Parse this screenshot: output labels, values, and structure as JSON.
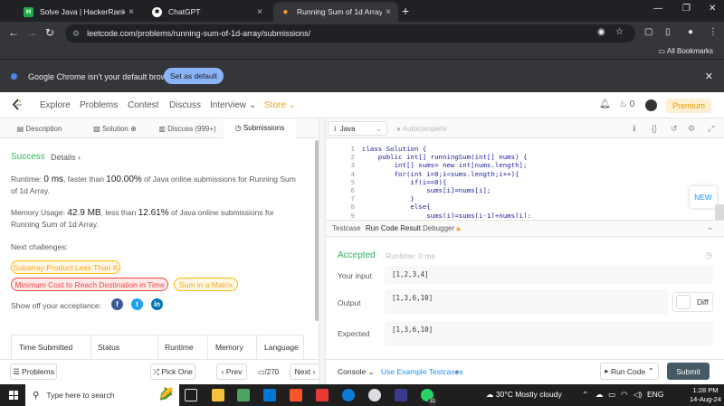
{
  "browser": {
    "tabs": [
      {
        "title": "Solve Java | HackerRank",
        "active": false
      },
      {
        "title": "ChatGPT",
        "active": false
      },
      {
        "title": "Running Sum of 1d Array - Lee",
        "active": true
      }
    ],
    "url": "leetcode.com/problems/running-sum-of-1d-array/submissions/",
    "all_bookmarks": "All Bookmarks",
    "infobar": {
      "message": "Google Chrome isn't your default browser",
      "button": "Set as default"
    }
  },
  "leetcode_nav": {
    "items": [
      "Explore",
      "Problems",
      "Contest",
      "Discuss",
      "Interview",
      "Store"
    ],
    "streak": "0",
    "premium": "Premium"
  },
  "left": {
    "tabs": [
      "Description",
      "Solution",
      "Discuss (999+)",
      "Submissions"
    ],
    "status": "Success",
    "details": "Details",
    "runtime_prefix": "Runtime: ",
    "runtime_value": "0 ms",
    "runtime_mid": ", faster than ",
    "runtime_pct": "100.00%",
    "runtime_suffix": " of Java online submissions for Running Sum of 1d Array.",
    "memory_prefix": "Memory Usage: ",
    "memory_value": "42.9 MB",
    "memory_mid": ", less than ",
    "memory_pct": "12.61%",
    "memory_suffix": " of Java online submissions for Running Sum of 1d Array.",
    "next_label": "Next challenges:",
    "challenges": [
      {
        "name": "Subarray Product Less Than K",
        "level": "med"
      },
      {
        "name": "Minimum Cost to Reach Destination in Time",
        "level": "hard"
      },
      {
        "name": "Sum in a Matrix",
        "level": "med"
      }
    ],
    "show_off": "Show off your acceptance:",
    "table_headers": [
      "Time Submitted",
      "Status",
      "Runtime",
      "Memory",
      "Language"
    ]
  },
  "left_footer": {
    "problems": "Problems",
    "pick_one": "Pick One",
    "prev": "Prev",
    "page": "/270",
    "next": "Next"
  },
  "editor": {
    "language": "Java",
    "autocomplete": "Autocomplete",
    "line_numbers": [
      "1",
      "2",
      "3",
      "4",
      "5",
      "6",
      "7",
      "8",
      "9"
    ],
    "lines": [
      "class Solution {",
      "    public int[] runningSum(int[] nums) {",
      "        int[] sums= new int[nums.length];",
      "        for(int i=0;i<sums.length;i++){",
      "            if(i==0){",
      "                sums[i]=nums[i];",
      "            }",
      "            else{",
      "                sums[i]=sums[i-1]+nums[i];"
    ],
    "new_badge": "NEW"
  },
  "console_tabs": [
    "Testcase",
    "Run Code Result",
    "Debugger"
  ],
  "result": {
    "status": "Accepted",
    "runtime": "Runtime: 0 ms",
    "your_input_label": "Your input",
    "your_input": "[1,2,3,4]",
    "output_label": "Output",
    "output": "[1,3,6,10]",
    "diff": "Diff",
    "expected_label": "Expected",
    "expected": "[1,3,6,10]"
  },
  "right_footer": {
    "console": "Console",
    "example": "Use Example Testcases",
    "run_code": "Run Code",
    "submit": "Submit"
  },
  "taskbar": {
    "search_placeholder": "Type here to search",
    "notification_count": "31",
    "weather": "30°C  Mostly cloudy",
    "lang": "ENG",
    "time": "1:28 PM",
    "date": "14-Aug-24"
  },
  "colors": {
    "success": "#2db55d",
    "medium": "#ffa116",
    "hard": "#ef4743",
    "link": "#1a90ff",
    "submit": "#455a64"
  }
}
